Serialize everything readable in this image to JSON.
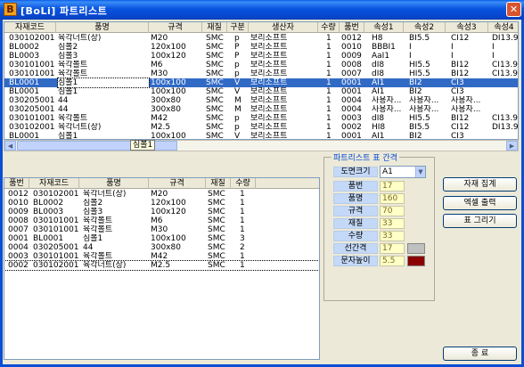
{
  "window": {
    "icon_letter": "B",
    "title": "[BoLi] 파트리스트",
    "close": "✕"
  },
  "top_table": {
    "columns": [
      "자재코드",
      "품명",
      "규격",
      "재질",
      "구분",
      "생산자",
      "수량",
      "품번",
      "속성1",
      "속성2",
      "속성3",
      "속성4"
    ],
    "rows": [
      [
        "030102001",
        "육각너트(상)",
        "M20",
        "SMC",
        "p",
        "보리소프트",
        "1",
        "0012",
        "H8",
        "BI5.5",
        "CI12",
        "DI13.9"
      ],
      [
        "BL0002",
        "심볼2",
        "120x100",
        "SMC",
        "P",
        "보리소프트",
        "1",
        "0010",
        "BBBI1",
        "I",
        "I",
        "I"
      ],
      [
        "BL0003",
        "심볼3",
        "100x120",
        "SMC",
        "P",
        "보리소프트",
        "1",
        "0009",
        "AaI1",
        "I",
        "I",
        "I"
      ],
      [
        "030101001",
        "육각볼트",
        "M6",
        "SMC",
        "p",
        "보리소프트",
        "1",
        "0008",
        "dI8",
        "HI5.5",
        "BI12",
        "CI13.9"
      ],
      [
        "030101001",
        "육각볼트",
        "M30",
        "SMC",
        "p",
        "보리소프트",
        "1",
        "0007",
        "dI8",
        "HI5.5",
        "BI12",
        "CI13.9"
      ],
      [
        "BL0001",
        "심볼1",
        "100x100",
        "SMC",
        "V",
        "보리소프트",
        "1",
        "0001",
        "AI1",
        "BI2",
        "CI3",
        ""
      ],
      [
        "BL0001",
        "심볼1",
        "100x100",
        "SMC",
        "V",
        "보리소프트",
        "1",
        "0001",
        "AI1",
        "BI2",
        "CI3",
        ""
      ],
      [
        "030205001",
        "44",
        "300x80",
        "SMC",
        "M",
        "보리소프트",
        "1",
        "0004",
        "사용자...",
        "사용자...",
        "사용자...",
        ""
      ],
      [
        "030205001",
        "44",
        "300x80",
        "SMC",
        "M",
        "보리소프트",
        "1",
        "0004",
        "사용자...",
        "사용자...",
        "사용자...",
        ""
      ],
      [
        "030101001",
        "육각볼트",
        "M42",
        "SMC",
        "p",
        "보리소프트",
        "1",
        "0003",
        "dI8",
        "HI5.5",
        "BI12",
        "CI13.9"
      ],
      [
        "030102001",
        "육각너트(상)",
        "M2.5",
        "SMC",
        "p",
        "보리소프트",
        "1",
        "0002",
        "HI8",
        "BI5.5",
        "CI12",
        "DI13.9"
      ],
      [
        "BL0001",
        "심볼1",
        "100x100",
        "SMC",
        "V",
        "보리소프트",
        "1",
        "0001",
        "AI1",
        "BI2",
        "CI3",
        ""
      ]
    ],
    "selected_row": 5,
    "scroll_tooltip": "심볼1"
  },
  "bottom_table": {
    "columns": [
      "품번",
      "자재코드",
      "품명",
      "규격",
      "재질",
      "수량"
    ],
    "rows": [
      [
        "0012",
        "030102001",
        "육각너트(상)",
        "M20",
        "SMC",
        "1"
      ],
      [
        "0010",
        "BL0002",
        "심볼2",
        "120x100",
        "SMC",
        "1"
      ],
      [
        "0009",
        "BL0003",
        "심볼3",
        "100x120",
        "SMC",
        "1"
      ],
      [
        "0008",
        "030101001",
        "육각볼트",
        "M6",
        "SMC",
        "1"
      ],
      [
        "0007",
        "030101001",
        "육각볼트",
        "M30",
        "SMC",
        "1"
      ],
      [
        "0001",
        "BL0001",
        "심볼1",
        "100x100",
        "SMC",
        "3"
      ],
      [
        "0004",
        "030205001",
        "44",
        "300x80",
        "SMC",
        "2"
      ],
      [
        "0003",
        "030101001",
        "육각볼트",
        "M42",
        "SMC",
        "1"
      ],
      [
        "0002",
        "030102001",
        "육각너트(상)",
        "M2.5",
        "SMC",
        "1"
      ]
    ]
  },
  "panel": {
    "title": "파트리스트 표 간격",
    "drawing_size_label": "도면크기",
    "drawing_size_value": "A1",
    "fields": [
      {
        "label": "품번",
        "value": "17"
      },
      {
        "label": "품명",
        "value": "160"
      },
      {
        "label": "규격",
        "value": "70"
      },
      {
        "label": "재질",
        "value": "33"
      },
      {
        "label": "수량",
        "value": "33"
      },
      {
        "label": "선간격",
        "value": "17"
      },
      {
        "label": "문자높이",
        "value": "5.5"
      }
    ],
    "line_color": "#c0c0c0",
    "text_color": "#8b0000"
  },
  "buttons": {
    "collect": "자재 집계",
    "excel": "엑셀 출력",
    "draw": "표 그리기",
    "close": "종   료"
  }
}
